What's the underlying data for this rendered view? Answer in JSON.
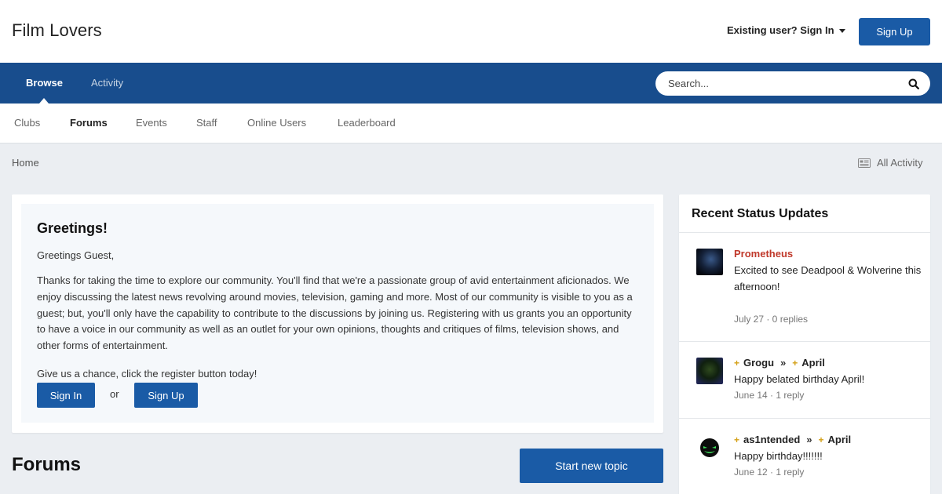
{
  "site": {
    "title": "Film Lovers"
  },
  "header": {
    "signin_label": "Existing user? Sign In",
    "signup_label": "Sign Up"
  },
  "nav": {
    "browse": "Browse",
    "activity": "Activity"
  },
  "search": {
    "placeholder": "Search..."
  },
  "subnav": {
    "items": [
      "Clubs",
      "Forums",
      "Events",
      "Staff",
      "Online Users",
      "Leaderboard"
    ],
    "active": "Forums"
  },
  "breadcrumb": {
    "home": "Home",
    "all_activity": "All Activity"
  },
  "greeting": {
    "title": "Greetings!",
    "guest": "Greetings Guest,",
    "body": "Thanks for taking the time to explore our community. You'll find that we're a passionate group of avid entertainment aficionados. We enjoy discussing the latest news revolving around movies, television, gaming and more. Most of our community is visible to you as a guest; but, you'll only have the capability to contribute to the discussions by joining us. Registering with us grants you an opportunity to have a voice in our community as well as an outlet for your own opinions, thoughts and critiques of films, television shows, and other forms of entertainment.",
    "cta": "Give us a chance, click the register button today!",
    "signin_label": "Sign In",
    "or": "or",
    "signup_label": "Sign Up"
  },
  "forums": {
    "title": "Forums",
    "start_topic": "Start new topic"
  },
  "status_updates": {
    "title": "Recent Status Updates",
    "items": [
      {
        "author": "Prometheus",
        "text": "Excited to see Deadpool & Wolverine this afternoon!",
        "meta": "July 27 · 0 replies"
      },
      {
        "author": "Grogu",
        "target": "April",
        "text": "Happy belated birthday April!",
        "meta": "June 14 · 1 reply"
      },
      {
        "author": "as1ntended",
        "target": "April",
        "text": "Happy birthday!!!!!!!",
        "meta": "June 12 · 1 reply"
      }
    ]
  },
  "colors": {
    "brand": "#1a5ba6",
    "navbar": "#184d8d",
    "author_red": "#c0392b",
    "plus_gold": "#d4a017"
  }
}
